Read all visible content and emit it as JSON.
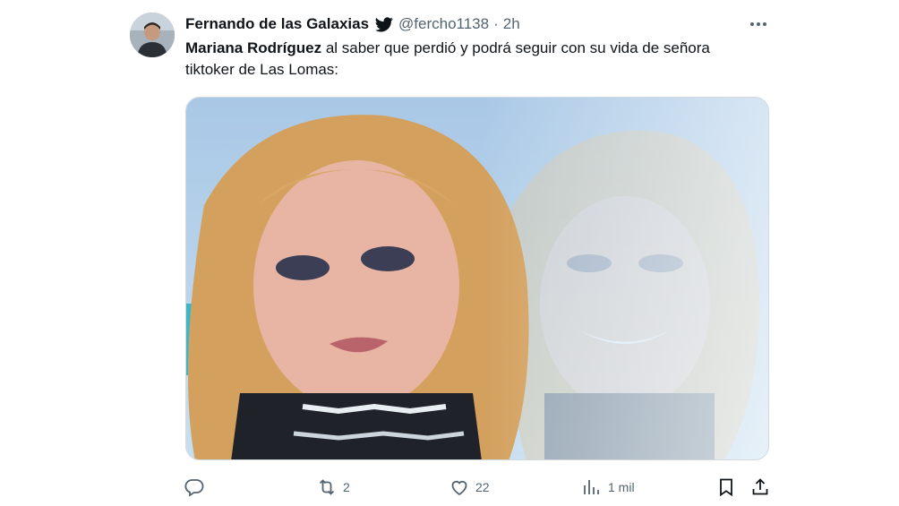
{
  "author": {
    "display_name": "Fernando de las Galaxias",
    "handle": "@fercho1138",
    "separator": "·",
    "time": "2h"
  },
  "tweet": {
    "mention": "Mariana Rodríguez",
    "text_rest": " al saber que perdió y podrá seguir con su vida de señora tiktoker de Las Lomas:"
  },
  "metrics": {
    "replies": "",
    "retweets": "2",
    "likes": "22",
    "views": "1 mil"
  },
  "icons": {
    "verified": "twitter-bird-icon",
    "more": "more-dots-icon",
    "reply": "reply-icon",
    "retweet": "retweet-icon",
    "like": "heart-icon",
    "views": "analytics-icon",
    "bookmark": "bookmark-icon",
    "share": "share-icon"
  },
  "colors": {
    "text_primary": "#0f1419",
    "text_secondary": "#536471",
    "twitter_blue": "#1d9bf0"
  }
}
